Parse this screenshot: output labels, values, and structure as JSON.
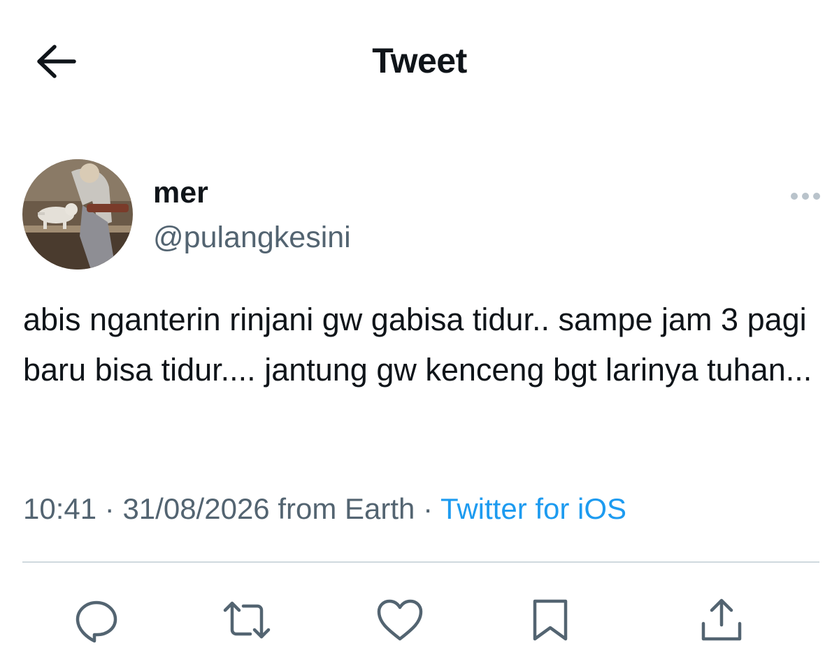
{
  "header": {
    "back_icon": "arrow-left-icon",
    "title": "Tweet"
  },
  "tweet": {
    "author": {
      "display_name": "mer",
      "handle": "@pulangkesini",
      "avatar_icon": "user-avatar-photo"
    },
    "more_icon": "more-horizontal-icon",
    "text": "abis nganterin rinjani gw gabisa tidur.. sampe jam 3 pagi baru bisa tidur.... jantung gw kenceng bgt larinya tuhan...",
    "time": "10:41",
    "separator": "·",
    "date": "31/08/2026",
    "location": "from Earth",
    "source": "Twitter for iOS"
  },
  "actions": [
    {
      "icon": "reply-icon"
    },
    {
      "icon": "retweet-icon"
    },
    {
      "icon": "like-icon"
    },
    {
      "icon": "bookmark-icon"
    },
    {
      "icon": "share-icon"
    }
  ],
  "colors": {
    "text_primary": "#0f1419",
    "text_secondary": "#536471",
    "link": "#1d9bf0",
    "divider": "#cfd9de"
  }
}
